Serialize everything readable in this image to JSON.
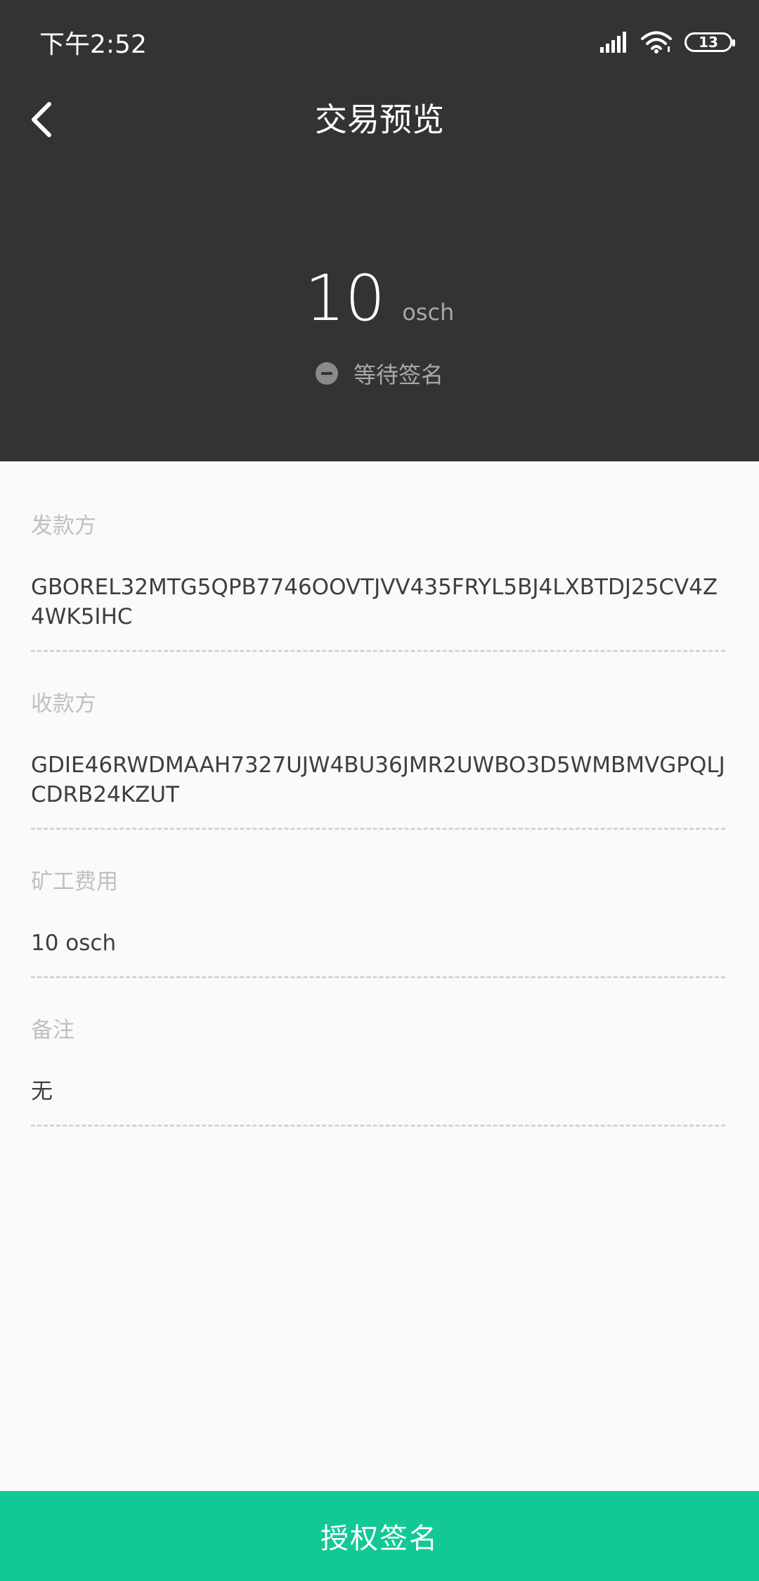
{
  "status_bar": {
    "time": "下午2:52",
    "battery_level": "13",
    "icons": [
      "signal-icon",
      "wifi-icon",
      "battery-icon"
    ]
  },
  "nav": {
    "back_icon": "chevron-left-icon",
    "title": "交易预览"
  },
  "summary": {
    "amount": "10",
    "unit": "osch",
    "status": "等待签名",
    "status_icon": "minus-circle-icon"
  },
  "details": {
    "sender": {
      "label": "发款方",
      "value": "GBOREL32MTG5QPB7746OOVTJVV435FRYL5BJ4LXBTDJ25CV4Z4WK5IHC"
    },
    "receiver": {
      "label": "收款方",
      "value": "GDIE46RWDMAAH7327UJW4BU36JMR2UWBO3D5WMBMVGPQLJCDRB24KZUT"
    },
    "fee": {
      "label": "矿工费用",
      "value": "10 osch"
    },
    "memo": {
      "label": "备注",
      "value": "无"
    }
  },
  "actions": {
    "sign_label": "授权签名"
  },
  "colors": {
    "header_bg": "#333335",
    "page_bg": "#fafafa",
    "accent": "#12c995",
    "label": "#c0c0c0",
    "value": "#3e3e3e"
  }
}
